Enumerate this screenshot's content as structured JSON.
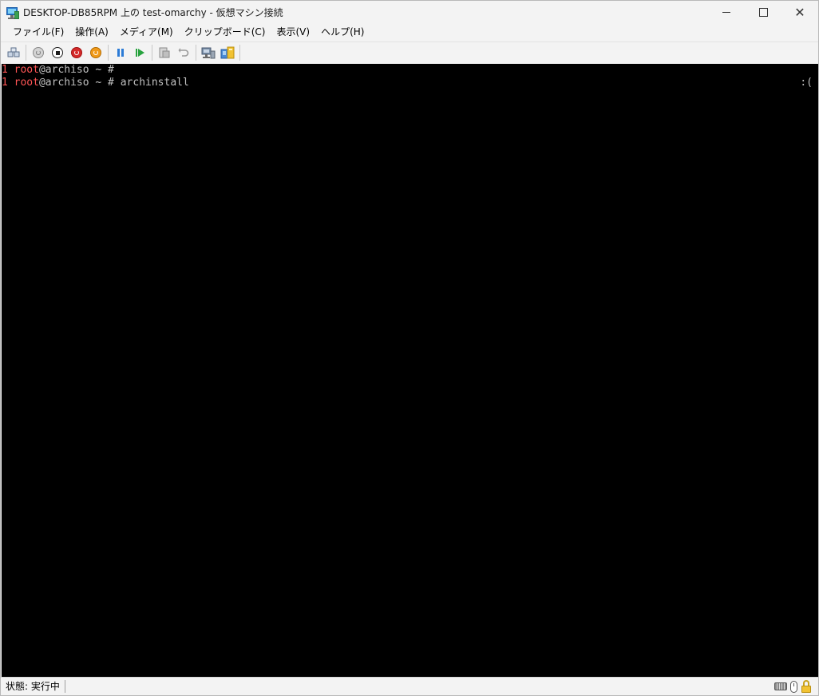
{
  "window": {
    "title": "DESKTOP-DB85RPM 上の test-omarchy - 仮想マシン接続"
  },
  "menu": {
    "items": [
      "ファイル(F)",
      "操作(A)",
      "メディア(M)",
      "クリップボード(C)",
      "表示(V)",
      "ヘルプ(H)"
    ]
  },
  "toolbar": {
    "buttons": [
      {
        "name": "ctrl-alt-del-icon"
      },
      {
        "name": "start-icon"
      },
      {
        "name": "turn-off-icon"
      },
      {
        "name": "shut-down-icon"
      },
      {
        "name": "save-icon"
      },
      {
        "name": "pause-icon"
      },
      {
        "name": "reset-icon"
      },
      {
        "name": "checkpoint-icon"
      },
      {
        "name": "revert-icon"
      },
      {
        "name": "enhanced-session-icon"
      },
      {
        "name": "share-icon"
      }
    ],
    "colors": {
      "start": "#8a8a8a",
      "turn_off": "#1d1d1d",
      "shut_down": "#d42a2a",
      "save": "#f09a1a",
      "pause": "#2b7bd6",
      "reset": "#27a23e"
    }
  },
  "terminal": {
    "background": "#000000",
    "lines": [
      {
        "num": "1",
        "user": "root",
        "rest": "@archiso ~ #"
      },
      {
        "num": "1",
        "user": "root",
        "rest": "@archiso ~ # archinstall"
      }
    ],
    "right_indicator": ":("
  },
  "status": {
    "text": "状態: 実行中"
  }
}
